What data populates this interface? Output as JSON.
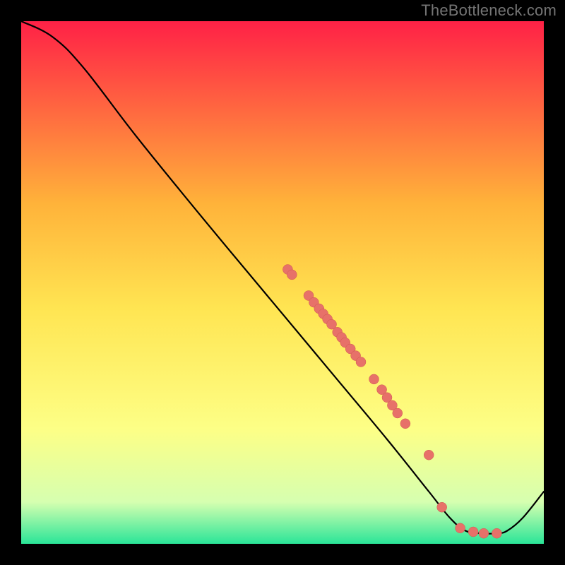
{
  "watermark": "TheBottleneck.com",
  "colors": {
    "background_black": "#000000",
    "gradient_top": "#ff2146",
    "gradient_mid_upper": "#ffb33a",
    "gradient_mid": "#ffe552",
    "gradient_lower": "#fdff86",
    "gradient_preGreen": "#d6ffb0",
    "gradient_green": "#2ae598",
    "curve": "#000000",
    "point_fill": "#e77169",
    "point_stroke": "#d05850"
  },
  "chart_data": {
    "type": "line",
    "xlim": [
      0,
      100
    ],
    "ylim": [
      0,
      100
    ],
    "xlabel": "",
    "ylabel": "",
    "title": "",
    "legend": false,
    "grid": false,
    "curve": [
      {
        "x": 0,
        "y": 100
      },
      {
        "x": 6,
        "y": 97
      },
      {
        "x": 12,
        "y": 91
      },
      {
        "x": 22,
        "y": 78
      },
      {
        "x": 35,
        "y": 62
      },
      {
        "x": 50,
        "y": 44
      },
      {
        "x": 60,
        "y": 32
      },
      {
        "x": 70,
        "y": 20
      },
      {
        "x": 78,
        "y": 10
      },
      {
        "x": 82,
        "y": 5
      },
      {
        "x": 85,
        "y": 2.5
      },
      {
        "x": 88,
        "y": 2
      },
      {
        "x": 91,
        "y": 2
      },
      {
        "x": 93,
        "y": 2.5
      },
      {
        "x": 96,
        "y": 5
      },
      {
        "x": 100,
        "y": 10
      }
    ],
    "points": [
      {
        "x": 51.0,
        "y": 52.5
      },
      {
        "x": 51.8,
        "y": 51.5
      },
      {
        "x": 55.0,
        "y": 47.5
      },
      {
        "x": 56.0,
        "y": 46.2
      },
      {
        "x": 57.0,
        "y": 45.0
      },
      {
        "x": 57.8,
        "y": 44.0
      },
      {
        "x": 58.6,
        "y": 43.0
      },
      {
        "x": 59.4,
        "y": 42.0
      },
      {
        "x": 60.5,
        "y": 40.5
      },
      {
        "x": 61.3,
        "y": 39.5
      },
      {
        "x": 62.0,
        "y": 38.5
      },
      {
        "x": 63.0,
        "y": 37.3
      },
      {
        "x": 64.0,
        "y": 36.0
      },
      {
        "x": 65.0,
        "y": 34.8
      },
      {
        "x": 67.5,
        "y": 31.5
      },
      {
        "x": 69.0,
        "y": 29.5
      },
      {
        "x": 70.0,
        "y": 28.0
      },
      {
        "x": 71.0,
        "y": 26.5
      },
      {
        "x": 72.0,
        "y": 25.0
      },
      {
        "x": 73.5,
        "y": 23.0
      },
      {
        "x": 78.0,
        "y": 17.0
      },
      {
        "x": 80.5,
        "y": 7.0
      },
      {
        "x": 84.0,
        "y": 3.0
      },
      {
        "x": 86.5,
        "y": 2.3
      },
      {
        "x": 88.5,
        "y": 2.0
      },
      {
        "x": 91.0,
        "y": 2.0
      }
    ],
    "point_radius_px": 7
  }
}
